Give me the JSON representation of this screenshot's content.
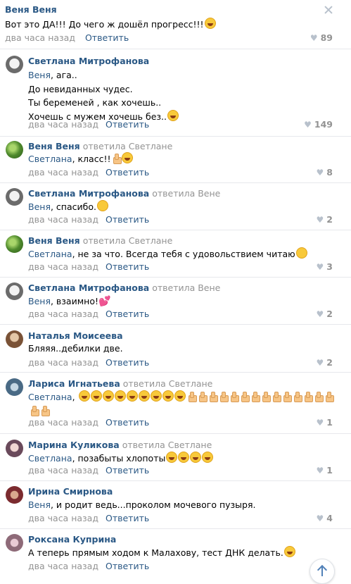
{
  "top": {
    "author": "Веня Веня",
    "text": "Вот это ДА!!! До чего ж дошёл прогресс!!!",
    "time": "два часа назад",
    "reply": "Ответить",
    "likes": "89"
  },
  "comments": [
    {
      "author": "Светлана Митрофанова",
      "replied_label": "",
      "lines": [
        "Веня, ага..",
        "До невиданных чудес.",
        "Ты беременей , как хочешь..",
        "Хочешь с мужем хочешь без.."
      ],
      "reply_to": "Веня",
      "time": "два часа назад",
      "reply": "Ответить",
      "likes": "149"
    },
    {
      "author": "Веня Веня",
      "replied_label": "ответила Светлане",
      "reply_to": "Светлана",
      "text": ", класс!!",
      "time": "два часа назад",
      "reply": "Ответить",
      "likes": "8"
    },
    {
      "author": "Светлана Митрофанова",
      "replied_label": "ответила Вене",
      "reply_to": "Веня",
      "text": ", спасибо.",
      "time": "два часа назад",
      "reply": "Ответить",
      "likes": "2"
    },
    {
      "author": "Веня Веня",
      "replied_label": "ответила Светлане",
      "reply_to": "Светлана",
      "text": ", не за что. Всегда тебя с удовольствием читаю",
      "time": "два часа назад",
      "reply": "Ответить",
      "likes": "3"
    },
    {
      "author": "Светлана Митрофанова",
      "replied_label": "ответила Вене",
      "reply_to": "Веня",
      "text": ", взаимно!",
      "time": "два часа назад",
      "reply": "Ответить",
      "likes": "2"
    },
    {
      "author": "Наталья Моисеева",
      "replied_label": "",
      "text": "Бляяя..дебилки две.",
      "time": "два часа назад",
      "reply": "Ответить",
      "likes": "2"
    },
    {
      "author": "Лариса Игнатьева",
      "replied_label": "ответила Светлане",
      "reply_to": "Светлана",
      "text": ",",
      "time": "два часа назад",
      "reply": "Ответить",
      "likes": "1"
    },
    {
      "author": "Марина Куликова",
      "replied_label": "ответила Светлане",
      "reply_to": "Светлана",
      "text": ", позабыты хлопоты",
      "time": "два часа назад",
      "reply": "Ответить",
      "likes": "1"
    },
    {
      "author": "Ирина Смирнова",
      "replied_label": "",
      "reply_to": "Веня",
      "text": ", и родит ведь...проколом мочевого пузыря.",
      "time": "два часа назад",
      "reply": "Ответить",
      "likes": "4"
    },
    {
      "author": "Роксана Куприна",
      "replied_label": "",
      "text": "А теперь прямым ходом к Малахову, тест ДНК делать.",
      "time": "два часа назад",
      "reply": "Ответить",
      "likes": ""
    }
  ],
  "icons": {
    "close": "close-icon",
    "heart": "heart-icon",
    "scroll_up": "arrow-up-icon"
  }
}
